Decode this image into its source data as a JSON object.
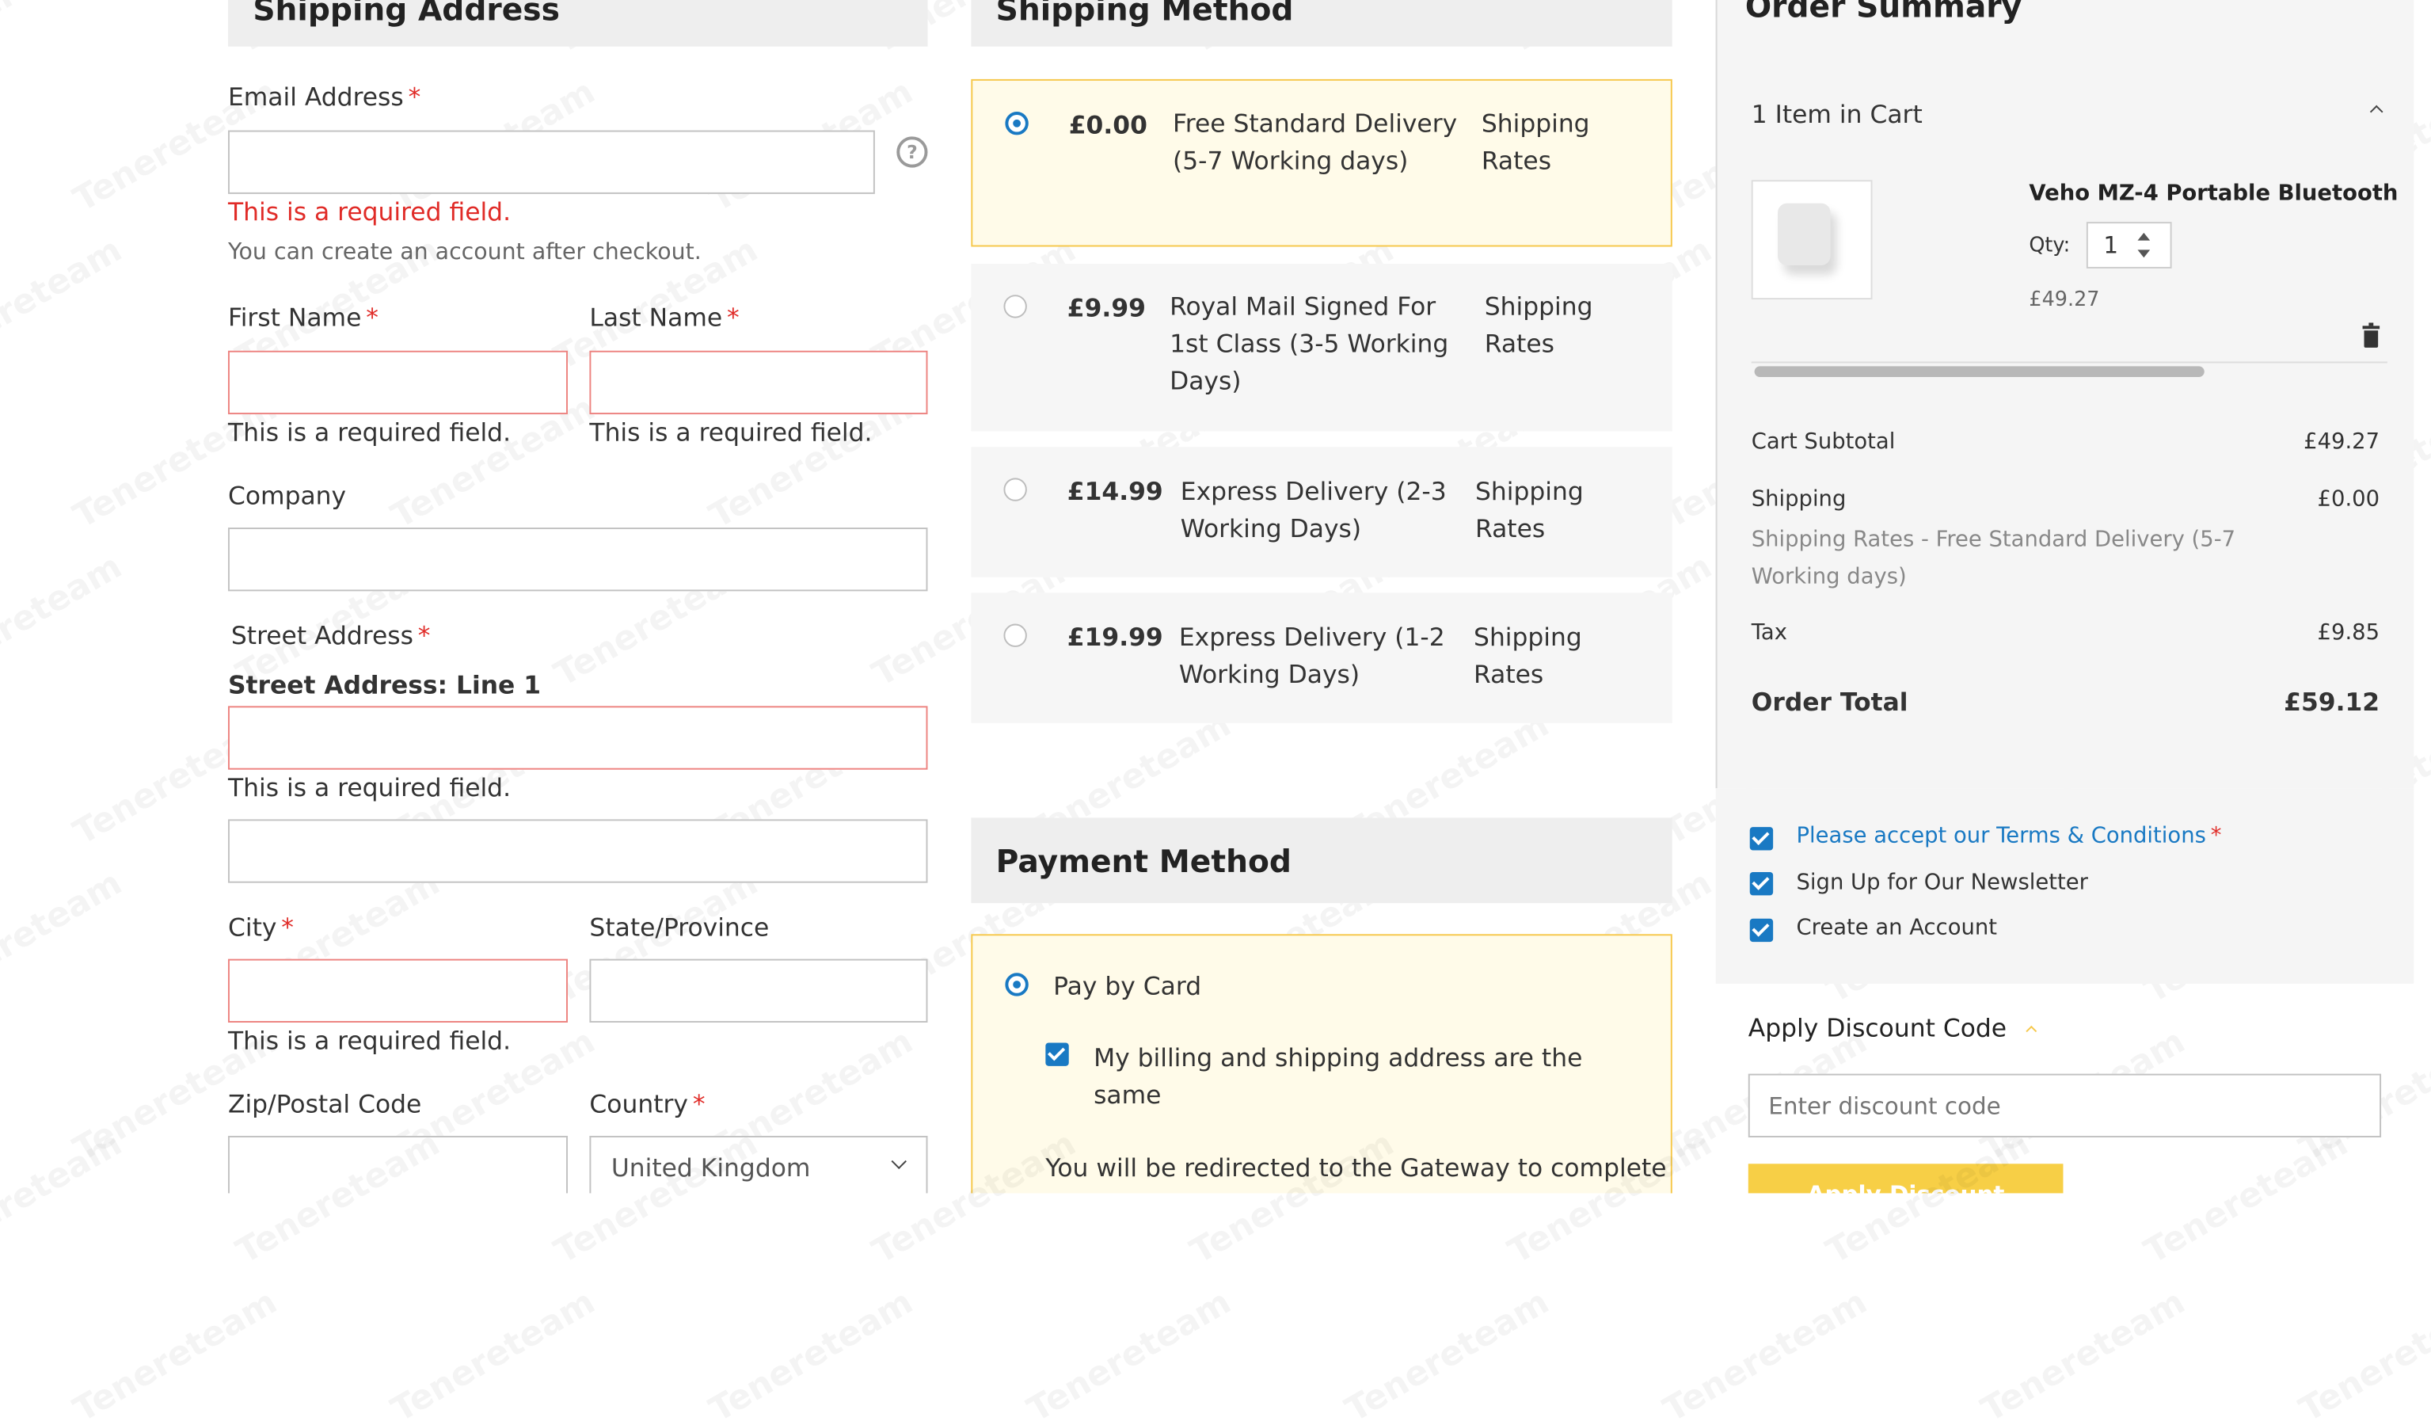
{
  "shipping_address": {
    "heading": "Shipping Address",
    "email_label": "Email Address",
    "email_error": "This is a required field.",
    "email_note": "You can create an account after checkout.",
    "first_name_label": "First Name",
    "last_name_label": "Last Name",
    "required_error": "This is a required field.",
    "company_label": "Company",
    "street_label": "Street Address",
    "street_line1_label": "Street Address: Line 1",
    "city_label": "City",
    "state_label": "State/Province",
    "zip_label": "Zip/Postal Code",
    "country_label": "Country",
    "country_value": "United Kingdom",
    "required_mark": "*",
    "help_icon": "?"
  },
  "shipping_method": {
    "heading": "Shipping Method",
    "options": [
      {
        "price": "£0.00",
        "name": "Free Standard Delivery (5-7 Working days)",
        "carrier": "Shipping Rates",
        "selected": true
      },
      {
        "price": "£9.99",
        "name": "Royal Mail Signed For 1st Class (3-5 Working Days)",
        "carrier": "Shipping Rates",
        "selected": false
      },
      {
        "price": "£14.99",
        "name": "Express Delivery (2-3 Working Days)",
        "carrier": "Shipping Rates",
        "selected": false
      },
      {
        "price": "£19.99",
        "name": "Express Delivery (1-2 Working Days)",
        "carrier": "Shipping Rates",
        "selected": false
      }
    ]
  },
  "payment_method": {
    "heading": "Payment Method",
    "option_label": "Pay by Card",
    "billing_same_label": "My billing and shipping address are the same",
    "redirect_text": "You will be redirected to the Gateway to complete"
  },
  "order_summary": {
    "heading": "Order Summary",
    "items_in_cart": "1 Item in Cart",
    "item_name": "Veho MZ-4 Portable Bluetooth",
    "qty_label": "Qty:",
    "qty_value": "1",
    "item_price": "£49.27",
    "cart_subtotal_label": "Cart Subtotal",
    "cart_subtotal_value": "£49.27",
    "shipping_label": "Shipping",
    "shipping_value": "£0.00",
    "shipping_desc": "Shipping Rates - Free Standard Delivery (5-7 Working days)",
    "tax_label": "Tax",
    "tax_value": "£9.85",
    "order_total_label": "Order Total",
    "order_total_value": "£59.12"
  },
  "agreements": {
    "terms_label": "Please accept our Terms & Conditions",
    "newsletter_label": "Sign Up for Our Newsletter",
    "create_account_label": "Create an Account"
  },
  "discount": {
    "heading": "Apply Discount Code",
    "placeholder": "Enter discount code",
    "button_label": "Apply Discount"
  },
  "watermark": "Tenereteam",
  "colors": {
    "accent_blue": "#1979c3",
    "error_red": "#e02b27",
    "highlight_yellow": "#f6c84c",
    "button_yellow": "#f7cf46"
  }
}
